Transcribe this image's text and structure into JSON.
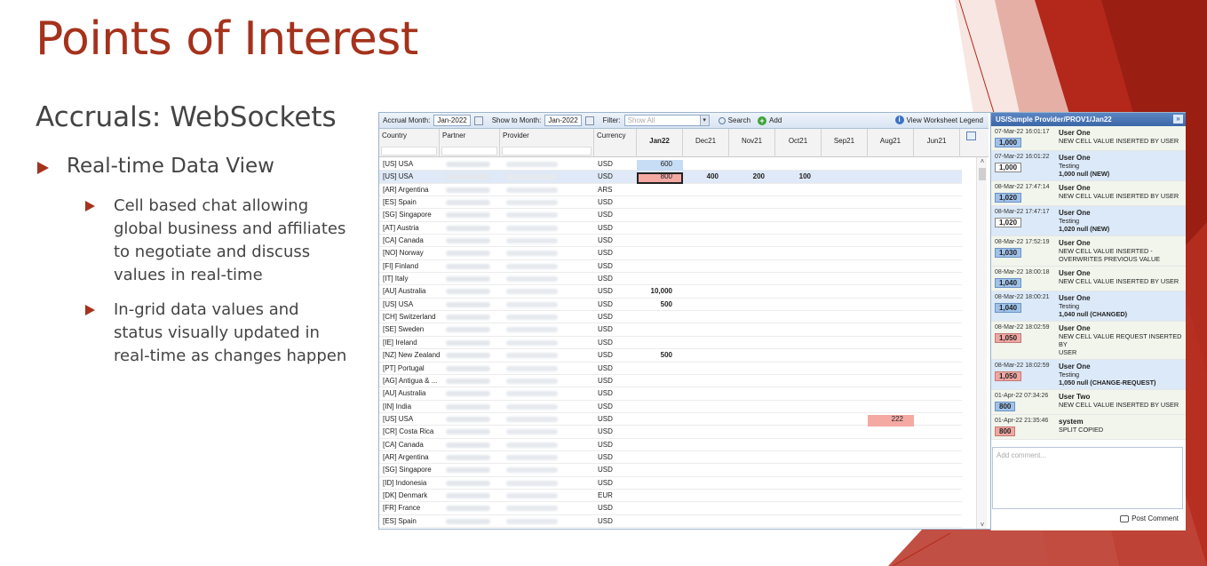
{
  "slide": {
    "title": "Points of Interest",
    "subtitle": "Accruals: WebSockets",
    "bullet_main": "Real-time Data View",
    "bullet_sub1": "Cell based chat allowing global business and affiliates to negotiate and discuss values in real-time",
    "bullet_sub2": "In-grid data values and status visually updated in real-time as changes happen",
    "colors": {
      "accent": "#a5321c",
      "deco_red": "#b3281a"
    }
  },
  "toolbar": {
    "accrual_month_label": "Accrual Month:",
    "accrual_month_value": "Jan-2022",
    "show_to_month_label": "Show to Month:",
    "show_to_month_value": "Jan-2022",
    "filter_label": "Filter:",
    "filter_placeholder": "Show All",
    "search_label": "Search",
    "add_label": "Add",
    "legend_label": "View Worksheet Legend"
  },
  "grid": {
    "headers": {
      "country": "Country",
      "partner": "Partner",
      "provider": "Provider",
      "currency": "Currency"
    },
    "months": [
      "Jan22",
      "Dec21",
      "Nov21",
      "Oct21",
      "Sep21",
      "Aug21",
      "Jun21"
    ],
    "rows": [
      {
        "country": "[US] USA",
        "currency": "USD",
        "vals": {
          "0": "600"
        }
      },
      {
        "country": "[US] USA",
        "currency": "USD",
        "vals": {
          "0": "800",
          "1": "400",
          "2": "200",
          "3": "100"
        }
      },
      {
        "country": "[AR] Argentina",
        "currency": "ARS",
        "vals": {}
      },
      {
        "country": "[ES] Spain",
        "currency": "USD",
        "vals": {}
      },
      {
        "country": "[SG] Singapore",
        "currency": "USD",
        "vals": {}
      },
      {
        "country": "[AT] Austria",
        "currency": "USD",
        "vals": {}
      },
      {
        "country": "[CA] Canada",
        "currency": "USD",
        "vals": {}
      },
      {
        "country": "[NO] Norway",
        "currency": "USD",
        "vals": {}
      },
      {
        "country": "[FI] Finland",
        "currency": "USD",
        "vals": {}
      },
      {
        "country": "[IT] Italy",
        "currency": "USD",
        "vals": {}
      },
      {
        "country": "[AU] Australia",
        "currency": "USD",
        "vals": {
          "0": "10,000"
        }
      },
      {
        "country": "[US] USA",
        "currency": "USD",
        "vals": {
          "0": "500"
        }
      },
      {
        "country": "[CH] Switzerland",
        "currency": "USD",
        "vals": {}
      },
      {
        "country": "[SE] Sweden",
        "currency": "USD",
        "vals": {}
      },
      {
        "country": "[IE] Ireland",
        "currency": "USD",
        "vals": {}
      },
      {
        "country": "[NZ] New Zealand",
        "currency": "USD",
        "vals": {
          "0": "500"
        }
      },
      {
        "country": "[PT] Portugal",
        "currency": "USD",
        "vals": {}
      },
      {
        "country": "[AG] Antigua & ...",
        "currency": "USD",
        "vals": {}
      },
      {
        "country": "[AU] Australia",
        "currency": "USD",
        "vals": {}
      },
      {
        "country": "[IN] India",
        "currency": "USD",
        "vals": {}
      },
      {
        "country": "[US] USA",
        "currency": "USD",
        "vals": {
          "5": "222"
        }
      },
      {
        "country": "[CR] Costa Rica",
        "currency": "USD",
        "vals": {}
      },
      {
        "country": "[CA] Canada",
        "currency": "USD",
        "vals": {}
      },
      {
        "country": "[AR] Argentina",
        "currency": "USD",
        "vals": {}
      },
      {
        "country": "[SG] Singapore",
        "currency": "USD",
        "vals": {}
      },
      {
        "country": "[ID] Indonesia",
        "currency": "USD",
        "vals": {}
      },
      {
        "country": "[DK] Denmark",
        "currency": "EUR",
        "vals": {}
      },
      {
        "country": "[FR] France",
        "currency": "USD",
        "vals": {}
      },
      {
        "country": "[ES] Spain",
        "currency": "USD",
        "vals": {}
      }
    ]
  },
  "chat": {
    "header": "US/Sample Provider/PROV1/Jan22",
    "messages": [
      {
        "ts": "07-Mar-22 16:01:17",
        "badge": "1,000",
        "badge_style": "blue",
        "user": "User One",
        "lines": [
          "NEW CELL VALUE INSERTED BY USER"
        ],
        "style": "plain"
      },
      {
        "ts": "07-Mar-22 16:01:22",
        "badge": "1,000",
        "badge_style": "white",
        "user": "User One",
        "lines": [
          "Testing"
        ],
        "bold_line": "1,000 null (NEW)",
        "style": "alt"
      },
      {
        "ts": "08-Mar-22 17:47:14",
        "badge": "1,020",
        "badge_style": "blue",
        "user": "User One",
        "lines": [
          "NEW CELL VALUE INSERTED BY USER"
        ],
        "style": "plain"
      },
      {
        "ts": "08-Mar-22 17:47:17",
        "badge": "1,020",
        "badge_style": "white",
        "user": "User One",
        "lines": [
          "Testing"
        ],
        "bold_line": "1,020 null (NEW)",
        "style": "alt"
      },
      {
        "ts": "08-Mar-22 17:52:19",
        "badge": "1,030",
        "badge_style": "blue",
        "user": "User One",
        "lines": [
          "NEW CELL VALUE INSERTED -",
          "OVERWRITES PREVIOUS VALUE"
        ],
        "style": "plain"
      },
      {
        "ts": "08-Mar-22 18:00:18",
        "badge": "1,040",
        "badge_style": "blue",
        "user": "User One",
        "lines": [
          "NEW CELL VALUE INSERTED BY USER"
        ],
        "style": "plain"
      },
      {
        "ts": "08-Mar-22 18:00:21",
        "badge": "1,040",
        "badge_style": "blue",
        "user": "User One",
        "lines": [
          "Testing"
        ],
        "bold_line": "1,040 null (CHANGED)",
        "style": "alt"
      },
      {
        "ts": "08-Mar-22 18:02:59",
        "badge": "1,050",
        "badge_style": "red",
        "user": "User One",
        "lines": [
          "NEW CELL VALUE REQUEST INSERTED BY",
          "USER"
        ],
        "style": "plain"
      },
      {
        "ts": "08-Mar-22 18:02:59",
        "badge": "1,050",
        "badge_style": "red",
        "user": "User One",
        "lines": [
          "Testing"
        ],
        "bold_line": "1,050 null (CHANGE-REQUEST)",
        "style": "alt"
      },
      {
        "ts": "01-Apr-22 07:34:26",
        "badge": "800",
        "badge_style": "blue",
        "user": "User Two",
        "lines": [
          "NEW CELL VALUE INSERTED BY USER"
        ],
        "style": "plain"
      },
      {
        "ts": "01-Apr-22 21:35:46",
        "badge": "800",
        "badge_style": "red",
        "user": "system",
        "lines": [
          "SPLIT COPIED"
        ],
        "style": "plain"
      }
    ],
    "comment_placeholder": "Add comment...",
    "post_label": "Post Comment"
  }
}
